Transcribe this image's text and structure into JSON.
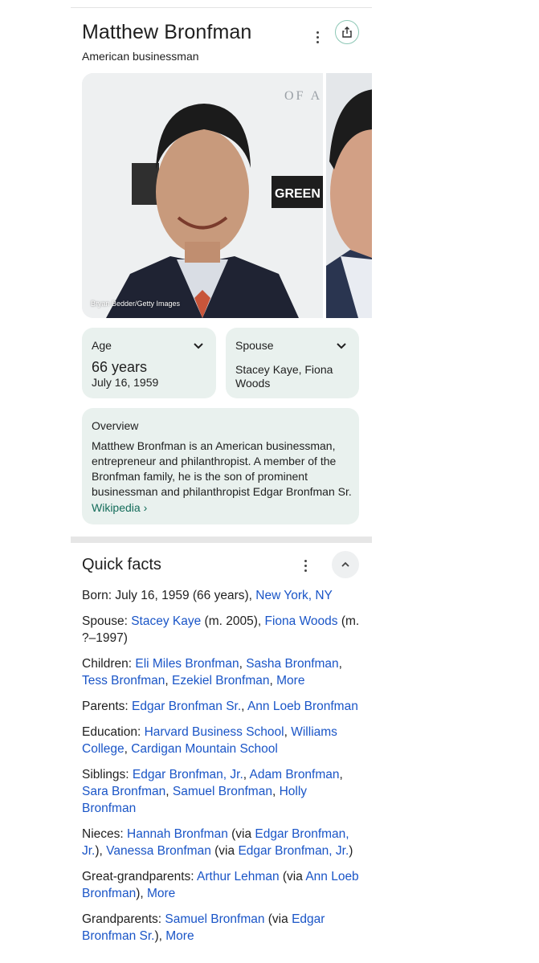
{
  "header": {
    "title": "Matthew Bronfman",
    "subtitle": "American businessman",
    "more_icon": "more-vertical-icon",
    "share_icon": "share-icon"
  },
  "images": {
    "credit": "Bryan Bedder/Getty Images"
  },
  "age": {
    "label": "Age",
    "value": "66 years",
    "date": "July 16, 1959"
  },
  "spouse": {
    "label": "Spouse",
    "value": "Stacey Kaye, Fiona Woods"
  },
  "overview": {
    "label": "Overview",
    "text": "Matthew Bronfman is an American businessman, entrepreneur and philanthropist. A member of the Bronfman family, he is the son of prominent businessman and philanthropist Edgar Bronfman Sr.",
    "source": "Wikipedia"
  },
  "quick_facts": {
    "title": "Quick facts",
    "facts": [
      {
        "label": "Born",
        "parts": [
          {
            "t": ": July 16, 1959 (66 years), "
          },
          {
            "t": "New York, NY",
            "link": true
          }
        ]
      },
      {
        "label": "Spouse",
        "parts": [
          {
            "t": ": "
          },
          {
            "t": "Stacey Kaye",
            "link": true
          },
          {
            "t": " (m. 2005), "
          },
          {
            "t": "Fiona Woods",
            "link": true
          },
          {
            "t": " (m. ?–1997)"
          }
        ]
      },
      {
        "label": "Children",
        "parts": [
          {
            "t": ": "
          },
          {
            "t": "Eli Miles Bronfman",
            "link": true
          },
          {
            "t": ", "
          },
          {
            "t": "Sasha Bronfman",
            "link": true
          },
          {
            "t": ", "
          },
          {
            "t": "Tess Bronfman",
            "link": true
          },
          {
            "t": ", "
          },
          {
            "t": "Ezekiel Bronfman",
            "link": true
          },
          {
            "t": ", "
          },
          {
            "t": "More",
            "link": true
          }
        ]
      },
      {
        "label": "Parents",
        "parts": [
          {
            "t": ": "
          },
          {
            "t": "Edgar Bronfman Sr.",
            "link": true
          },
          {
            "t": ", "
          },
          {
            "t": "Ann Loeb Bronfman",
            "link": true
          }
        ]
      },
      {
        "label": "Education",
        "parts": [
          {
            "t": ": "
          },
          {
            "t": "Harvard Business School",
            "link": true
          },
          {
            "t": ", "
          },
          {
            "t": "Williams College",
            "link": true
          },
          {
            "t": ", "
          },
          {
            "t": "Cardigan Mountain School",
            "link": true
          }
        ]
      },
      {
        "label": "Siblings",
        "parts": [
          {
            "t": ": "
          },
          {
            "t": "Edgar Bronfman, Jr.",
            "link": true
          },
          {
            "t": ", "
          },
          {
            "t": "Adam Bronfman",
            "link": true
          },
          {
            "t": ", "
          },
          {
            "t": "Sara Bronfman",
            "link": true
          },
          {
            "t": ", "
          },
          {
            "t": "Samuel Bronfman",
            "link": true
          },
          {
            "t": ", "
          },
          {
            "t": "Holly Bronfman",
            "link": true
          }
        ]
      },
      {
        "label": "Nieces",
        "parts": [
          {
            "t": ": "
          },
          {
            "t": "Hannah Bronfman",
            "link": true
          },
          {
            "t": " (via "
          },
          {
            "t": "Edgar Bronfman, Jr.",
            "link": true
          },
          {
            "t": "), "
          },
          {
            "t": "Vanessa Bronfman",
            "link": true
          },
          {
            "t": " (via "
          },
          {
            "t": "Edgar Bronfman, Jr.",
            "link": true
          },
          {
            "t": ")"
          }
        ]
      },
      {
        "label": "Great-grandparents",
        "parts": [
          {
            "t": ": "
          },
          {
            "t": "Arthur Lehman",
            "link": true
          },
          {
            "t": " (via "
          },
          {
            "t": "Ann Loeb Bronfman",
            "link": true
          },
          {
            "t": "), "
          },
          {
            "t": "More",
            "link": true
          }
        ]
      },
      {
        "label": "Grandparents",
        "parts": [
          {
            "t": ": "
          },
          {
            "t": "Samuel Bronfman",
            "link": true
          },
          {
            "t": " (via "
          },
          {
            "t": "Edgar Bronfman Sr.",
            "link": true
          },
          {
            "t": "), "
          },
          {
            "t": "More",
            "link": true
          }
        ]
      }
    ]
  },
  "colors": {
    "card_bg": "#e9f1ee",
    "link": "#1a55c7",
    "wiki_link": "#146c5a"
  }
}
